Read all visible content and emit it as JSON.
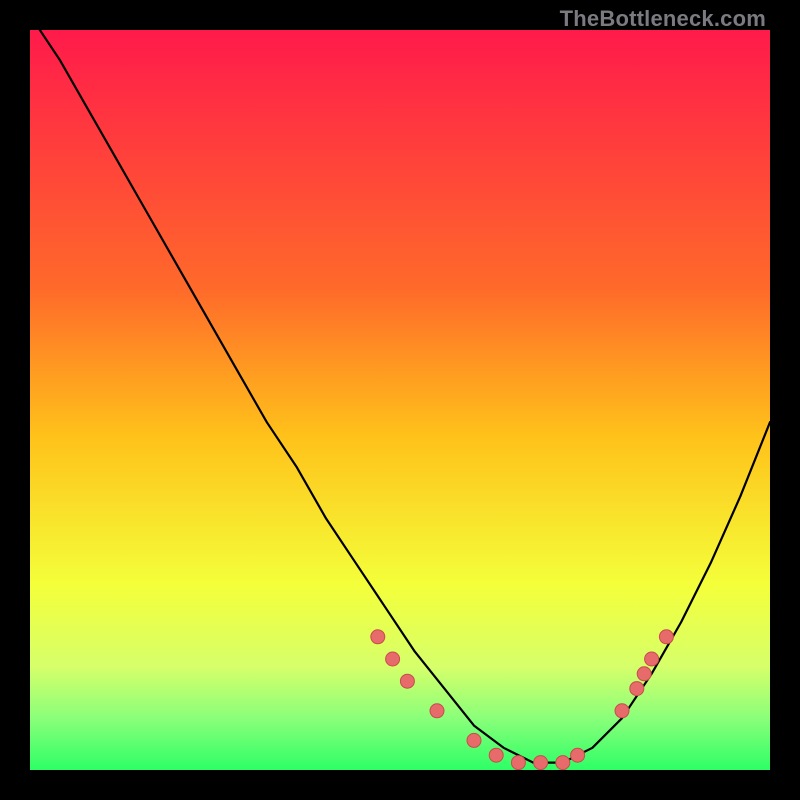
{
  "watermark": "TheBottleneck.com",
  "chart_data": {
    "type": "line",
    "title": "",
    "xlabel": "",
    "ylabel": "",
    "xlim": [
      0,
      100
    ],
    "ylim": [
      0,
      100
    ],
    "gradient_stops": [
      {
        "offset": 0,
        "color": "#ff1a4b"
      },
      {
        "offset": 35,
        "color": "#ff6a2a"
      },
      {
        "offset": 55,
        "color": "#ffc21a"
      },
      {
        "offset": 75,
        "color": "#f4ff3a"
      },
      {
        "offset": 86,
        "color": "#d6ff6a"
      },
      {
        "offset": 93,
        "color": "#8aff7a"
      },
      {
        "offset": 100,
        "color": "#2dff66"
      }
    ],
    "series": [
      {
        "name": "bottleneck-curve",
        "stroke": "#000000",
        "x": [
          0,
          4,
          8,
          12,
          16,
          20,
          24,
          28,
          32,
          36,
          40,
          44,
          48,
          52,
          56,
          60,
          64,
          68,
          72,
          76,
          80,
          84,
          88,
          92,
          96,
          100
        ],
        "y": [
          102,
          96,
          89,
          82,
          75,
          68,
          61,
          54,
          47,
          41,
          34,
          28,
          22,
          16,
          11,
          6,
          3,
          1,
          1,
          3,
          7,
          13,
          20,
          28,
          37,
          47
        ]
      }
    ],
    "markers": {
      "name": "highlight-points",
      "fill": "#e86b6b",
      "stroke": "#c94b4b",
      "radius": 7,
      "points": [
        {
          "x": 47,
          "y": 18
        },
        {
          "x": 49,
          "y": 15
        },
        {
          "x": 51,
          "y": 12
        },
        {
          "x": 55,
          "y": 8
        },
        {
          "x": 60,
          "y": 4
        },
        {
          "x": 63,
          "y": 2
        },
        {
          "x": 66,
          "y": 1
        },
        {
          "x": 69,
          "y": 1
        },
        {
          "x": 72,
          "y": 1
        },
        {
          "x": 74,
          "y": 2
        },
        {
          "x": 80,
          "y": 8
        },
        {
          "x": 82,
          "y": 11
        },
        {
          "x": 83,
          "y": 13
        },
        {
          "x": 84,
          "y": 15
        },
        {
          "x": 86,
          "y": 18
        }
      ]
    }
  }
}
